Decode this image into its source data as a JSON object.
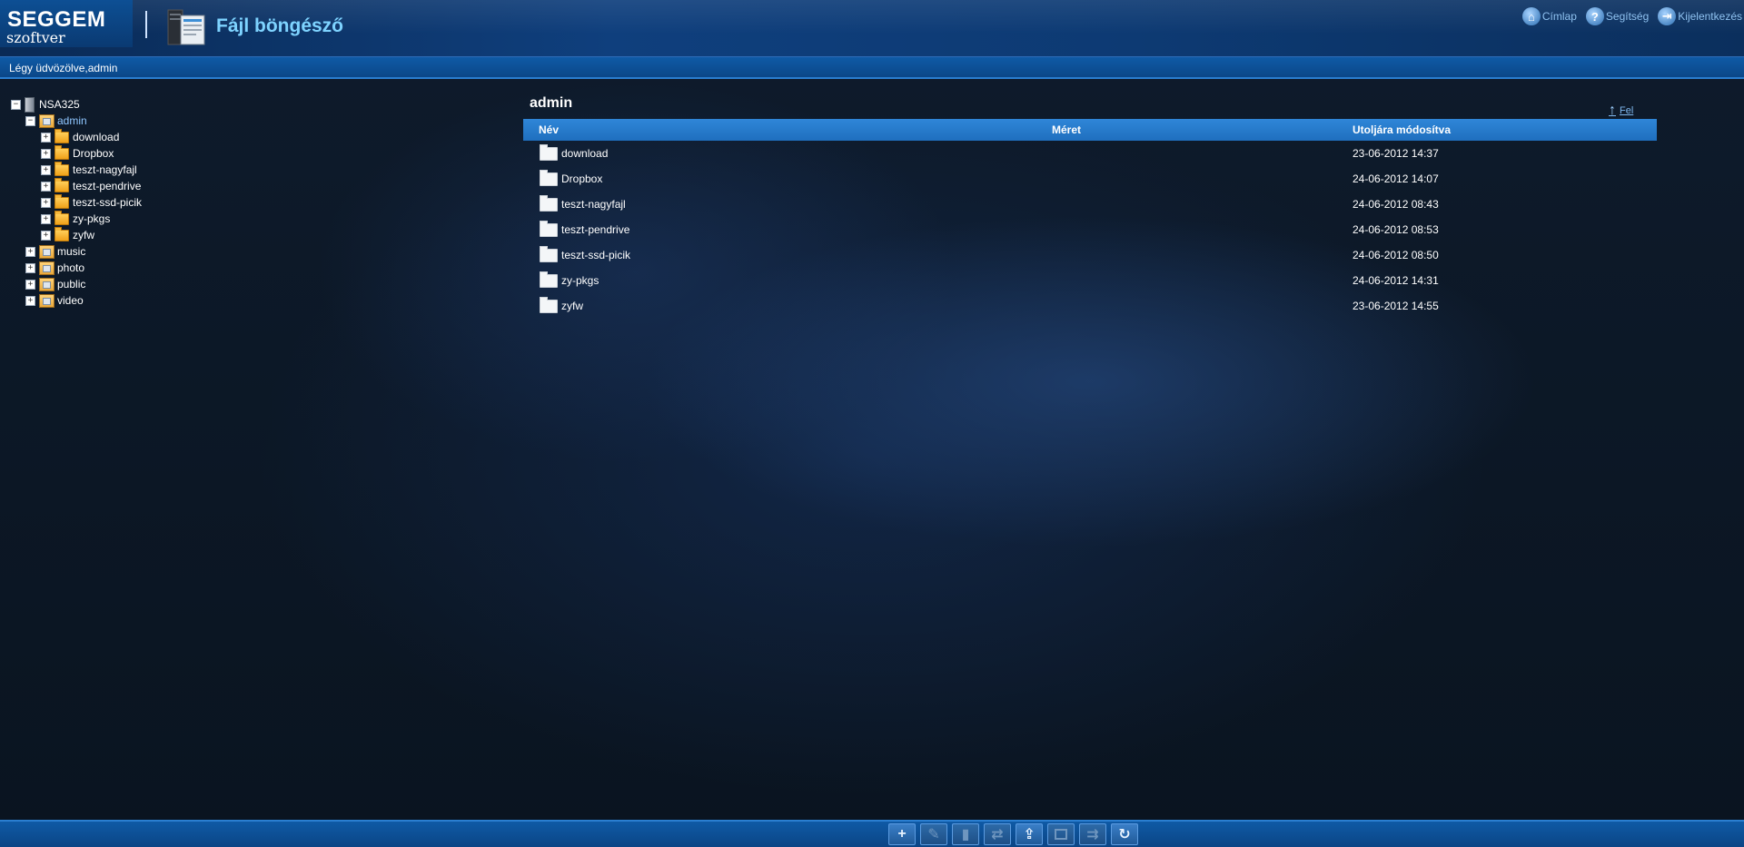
{
  "header": {
    "logo_title": "SEGGEM",
    "logo_subtitle": "szoftver",
    "app_title": "Fájl böngésző",
    "nav": [
      {
        "label": "Címlap",
        "icon": "home-icon"
      },
      {
        "label": "Segítség",
        "icon": "help-icon"
      },
      {
        "label": "Kijelentkezés",
        "icon": "logout-icon"
      }
    ]
  },
  "welcome_text": "Légy üdvözölve,admin",
  "tree": {
    "root": "NSA325",
    "items": [
      {
        "label": "admin",
        "level": 1,
        "expanded": true,
        "active": true,
        "type": "share"
      },
      {
        "label": "download",
        "level": 2,
        "type": "folder"
      },
      {
        "label": "Dropbox",
        "level": 2,
        "type": "folder"
      },
      {
        "label": "teszt-nagyfajl",
        "level": 2,
        "type": "folder"
      },
      {
        "label": "teszt-pendrive",
        "level": 2,
        "type": "folder"
      },
      {
        "label": "teszt-ssd-picik",
        "level": 2,
        "type": "folder"
      },
      {
        "label": "zy-pkgs",
        "level": 2,
        "type": "folder"
      },
      {
        "label": "zyfw",
        "level": 2,
        "type": "folder"
      },
      {
        "label": "music",
        "level": 1,
        "type": "share"
      },
      {
        "label": "photo",
        "level": 1,
        "type": "share"
      },
      {
        "label": "public",
        "level": 1,
        "type": "share"
      },
      {
        "label": "video",
        "level": 1,
        "type": "share"
      }
    ]
  },
  "main": {
    "title": "admin",
    "up_label": "Fel",
    "columns": {
      "name": "Név",
      "size": "Méret",
      "modified": "Utoljára módosítva"
    },
    "rows": [
      {
        "name": "download",
        "size": "",
        "modified": "23-06-2012 14:37"
      },
      {
        "name": "Dropbox",
        "size": "",
        "modified": "24-06-2012 14:07"
      },
      {
        "name": "teszt-nagyfajl",
        "size": "",
        "modified": "24-06-2012 08:43"
      },
      {
        "name": "teszt-pendrive",
        "size": "",
        "modified": "24-06-2012 08:53"
      },
      {
        "name": "teszt-ssd-picik",
        "size": "",
        "modified": "24-06-2012 08:50"
      },
      {
        "name": "zy-pkgs",
        "size": "",
        "modified": "24-06-2012 14:31"
      },
      {
        "name": "zyfw",
        "size": "",
        "modified": "23-06-2012 14:55"
      }
    ]
  },
  "toolbar": {
    "buttons": [
      {
        "icon": "add-icon",
        "enabled": true
      },
      {
        "icon": "rename-icon",
        "enabled": false
      },
      {
        "icon": "delete-icon",
        "enabled": false
      },
      {
        "icon": "move-icon",
        "enabled": false
      },
      {
        "icon": "upload-icon",
        "enabled": true
      },
      {
        "icon": "copy-icon",
        "enabled": false
      },
      {
        "icon": "cut-icon",
        "enabled": false
      },
      {
        "icon": "refresh-icon",
        "enabled": true
      }
    ]
  },
  "colors": {
    "accent": "#1f6fbe",
    "app_title": "#7ed3ff",
    "link": "#8fc6ff"
  }
}
